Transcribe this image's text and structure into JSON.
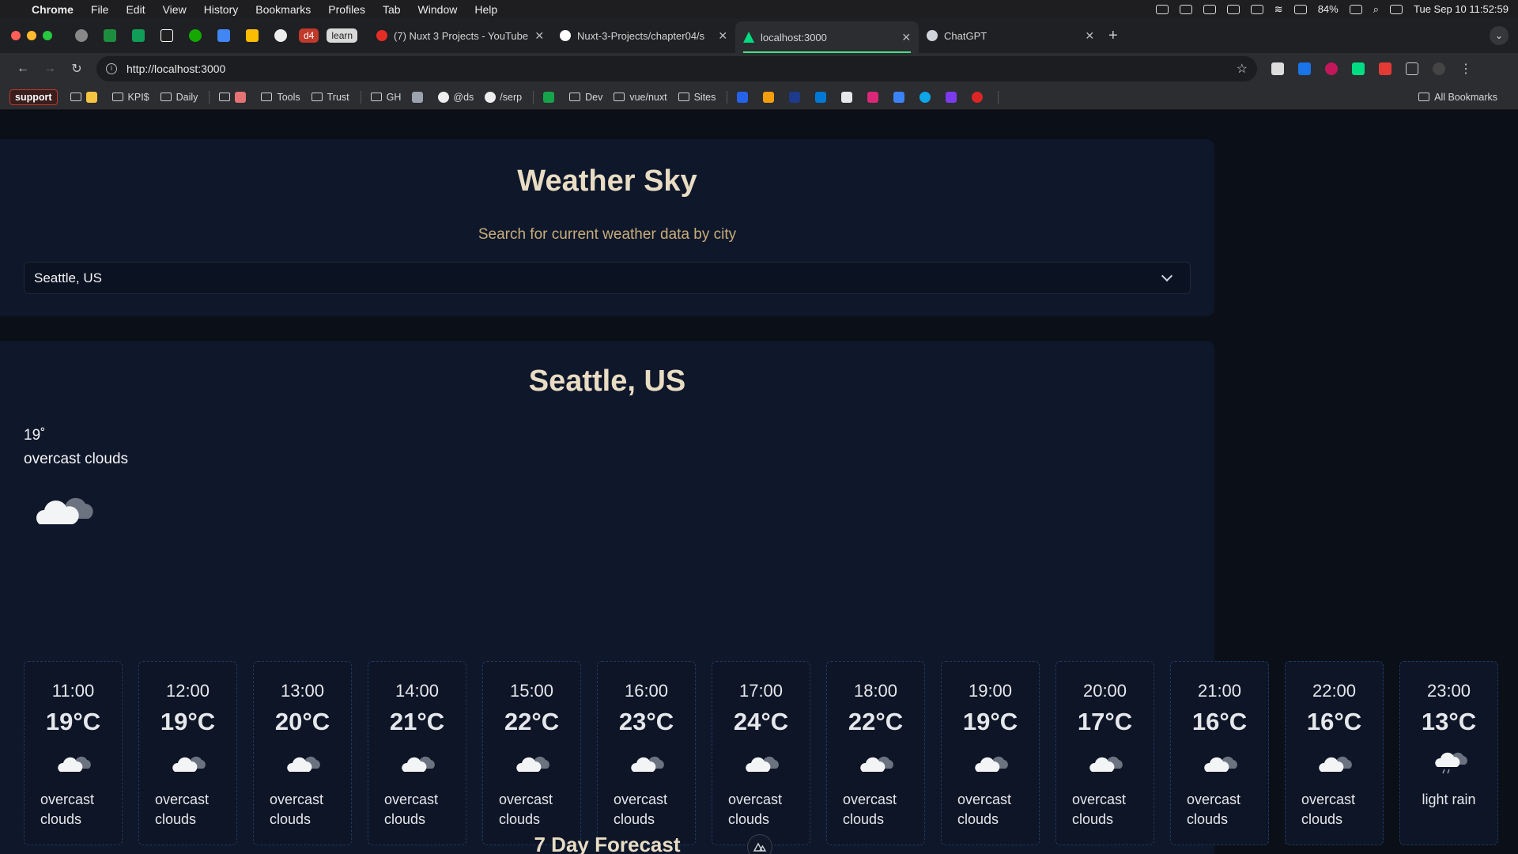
{
  "menubar": {
    "app_name": "Chrome",
    "items": [
      "File",
      "Edit",
      "View",
      "History",
      "Bookmarks",
      "Profiles",
      "Tab",
      "Window",
      "Help"
    ],
    "battery": "84%",
    "clock": "Tue Sep 10  11:52:59"
  },
  "tabs": {
    "pinned_text": [
      "d4",
      "learn"
    ],
    "items": [
      {
        "label": "(7) Nuxt 3 Projects - YouTube",
        "favicon_color": "#e52d27"
      },
      {
        "label": "Nuxt-3-Projects/chapter04/s",
        "favicon_color": "#ffffff"
      },
      {
        "label": "localhost:3000",
        "favicon_color": "#00dc82"
      },
      {
        "label": "ChatGPT",
        "favicon_color": "#d1d5db"
      }
    ]
  },
  "address_bar": {
    "url": "http://localhost:3000"
  },
  "bookmarks": {
    "badge": "support",
    "items": [
      "KPI$",
      "Daily",
      "Tools",
      "Trust",
      "GH",
      "@ds",
      "/serp",
      "Dev",
      "vue/nuxt",
      "Sites"
    ],
    "all_bookmarks": "All Bookmarks"
  },
  "app": {
    "title": "Weather Sky",
    "subtitle": "Search for current weather data by city",
    "selected_city": "Seattle, US"
  },
  "current": {
    "city": "Seattle, US",
    "temp": "19˚",
    "description": "overcast clouds",
    "icon": "overcast-clouds-icon"
  },
  "hourly": [
    {
      "time": "11:00",
      "temp": "19°C",
      "desc": "overcast clouds",
      "icon": "cloud-icon"
    },
    {
      "time": "12:00",
      "temp": "19°C",
      "desc": "overcast clouds",
      "icon": "cloud-icon"
    },
    {
      "time": "13:00",
      "temp": "20°C",
      "desc": "overcast clouds",
      "icon": "cloud-icon"
    },
    {
      "time": "14:00",
      "temp": "21°C",
      "desc": "overcast clouds",
      "icon": "cloud-icon"
    },
    {
      "time": "15:00",
      "temp": "22°C",
      "desc": "overcast clouds",
      "icon": "cloud-icon"
    },
    {
      "time": "16:00",
      "temp": "23°C",
      "desc": "overcast clouds",
      "icon": "cloud-icon"
    },
    {
      "time": "17:00",
      "temp": "24°C",
      "desc": "overcast clouds",
      "icon": "cloud-icon"
    },
    {
      "time": "18:00",
      "temp": "22°C",
      "desc": "overcast clouds",
      "icon": "cloud-icon"
    },
    {
      "time": "19:00",
      "temp": "19°C",
      "desc": "overcast clouds",
      "icon": "cloud-icon"
    },
    {
      "time": "20:00",
      "temp": "17°C",
      "desc": "overcast clouds",
      "icon": "cloud-icon"
    },
    {
      "time": "21:00",
      "temp": "16°C",
      "desc": "overcast clouds",
      "icon": "cloud-icon"
    },
    {
      "time": "22:00",
      "temp": "16°C",
      "desc": "overcast clouds",
      "icon": "cloud-icon"
    },
    {
      "time": "23:00",
      "temp": "13°C",
      "desc": "light rain",
      "icon": "rain-cloud-icon"
    }
  ],
  "forecast": {
    "heading": "7 Day Forecast"
  }
}
